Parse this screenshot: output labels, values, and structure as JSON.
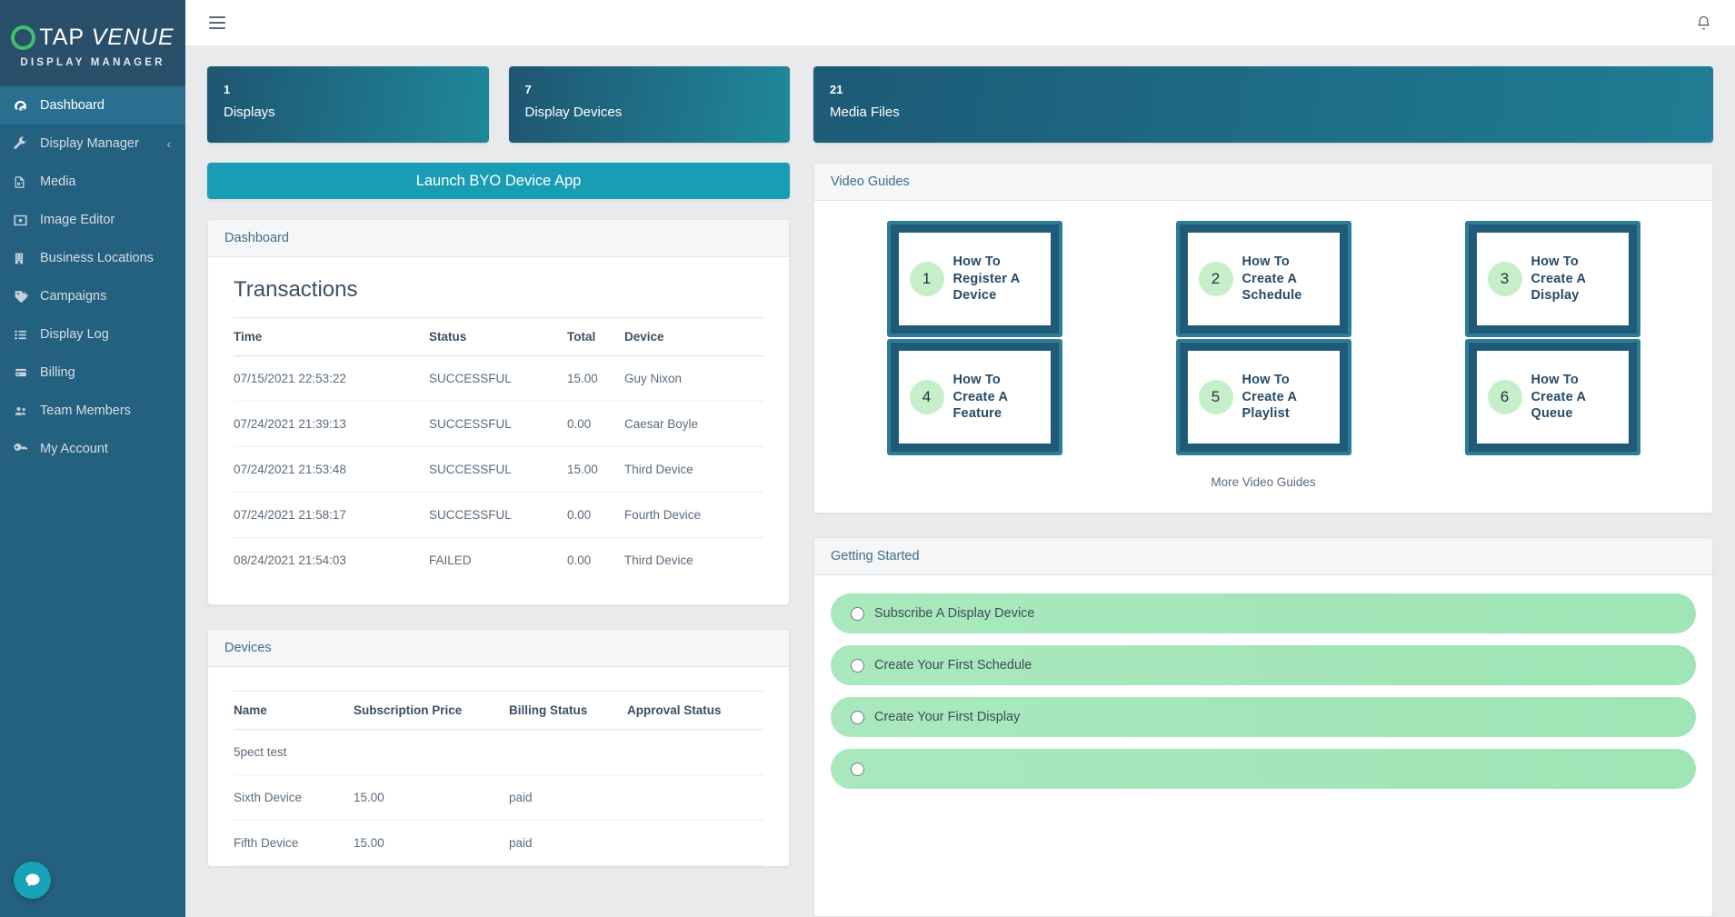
{
  "brand": {
    "name_part1": "TAP ",
    "name_part2": "VENUE",
    "subtitle": "DISPLAY MANAGER"
  },
  "sidebar": {
    "items": [
      {
        "label": "Dashboard",
        "icon": "dashboard-icon",
        "active": true
      },
      {
        "label": "Display Manager",
        "icon": "wrench-icon",
        "active": false,
        "caret": "‹"
      },
      {
        "label": "Media",
        "icon": "file-video-icon",
        "active": false
      },
      {
        "label": "Image Editor",
        "icon": "image-icon",
        "active": false
      },
      {
        "label": "Business Locations",
        "icon": "building-icon",
        "active": false
      },
      {
        "label": "Campaigns",
        "icon": "tag-icon",
        "active": false
      },
      {
        "label": "Display Log",
        "icon": "list-icon",
        "active": false
      },
      {
        "label": "Billing",
        "icon": "credit-card-icon",
        "active": false
      },
      {
        "label": "Team Members",
        "icon": "users-icon",
        "active": false
      },
      {
        "label": "My Account",
        "icon": "key-icon",
        "active": false
      }
    ]
  },
  "topbar": {
    "menu_icon": "hamburger-icon",
    "notification_icon": "bell-icon"
  },
  "stats": [
    {
      "value": "1",
      "label": "Displays"
    },
    {
      "value": "7",
      "label": "Display Devices"
    },
    {
      "value": "21",
      "label": "Media Files"
    }
  ],
  "launch_button": {
    "label": "Launch BYO Device App"
  },
  "dashboard_panel": {
    "header": "Dashboard",
    "transactions": {
      "title": "Transactions",
      "columns": [
        "Time",
        "Status",
        "Total",
        "Device"
      ],
      "rows": [
        [
          "07/15/2021 22:53:22",
          "SUCCESSFUL",
          "15.00",
          "Guy Nixon"
        ],
        [
          "07/24/2021 21:39:13",
          "SUCCESSFUL",
          "0.00",
          "Caesar Boyle"
        ],
        [
          "07/24/2021 21:53:48",
          "SUCCESSFUL",
          "15.00",
          "Third Device"
        ],
        [
          "07/24/2021 21:58:17",
          "SUCCESSFUL",
          "0.00",
          "Fourth Device"
        ],
        [
          "08/24/2021 21:54:03",
          "FAILED",
          "0.00",
          "Third Device"
        ]
      ]
    }
  },
  "devices_panel": {
    "header": "Devices",
    "columns": [
      "Name",
      "Subscription Price",
      "Billing Status",
      "Approval Status"
    ],
    "rows": [
      [
        "5pect test",
        "",
        "",
        ""
      ],
      [
        "Sixth Device",
        "15.00",
        "paid",
        ""
      ],
      [
        "Fifth Device",
        "15.00",
        "paid",
        ""
      ]
    ]
  },
  "video_guides": {
    "header": "Video Guides",
    "more_label": "More Video Guides",
    "cards": [
      {
        "number": "1",
        "title": "How To Register A Device"
      },
      {
        "number": "2",
        "title": "How To Create A Schedule"
      },
      {
        "number": "3",
        "title": "How To Create A Display"
      },
      {
        "number": "4",
        "title": "How To Create A Feature"
      },
      {
        "number": "5",
        "title": "How To Create A Playlist"
      },
      {
        "number": "6",
        "title": "How To Create A Queue"
      }
    ]
  },
  "getting_started": {
    "header": "Getting Started",
    "items": [
      {
        "label": "Subscribe A Display Device"
      },
      {
        "label": "Create Your First Schedule"
      },
      {
        "label": "Create Your First Display"
      },
      {
        "label": ""
      }
    ]
  },
  "chat": {
    "icon": "chat-bubble-icon"
  },
  "colors": {
    "sidebar_bg": "#24607f",
    "brand_bg": "#2a4f6b",
    "accent_teal": "#199db4",
    "stat_gradient_start": "#1f5570",
    "stat_gradient_end": "#1f889b",
    "green_pill": "#a9e8bd",
    "guide_frame": "#1f5b78",
    "guide_border": "#2d7d96"
  }
}
